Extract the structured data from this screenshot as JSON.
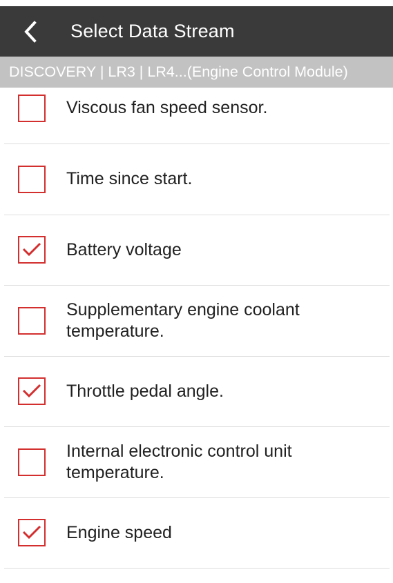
{
  "header": {
    "title": "Select Data Stream",
    "back_icon": "chevron-left-icon"
  },
  "subheader": {
    "text": "DISCOVERY | LR3 | LR4...(Engine Control Module)"
  },
  "colors": {
    "app_bar": "#3a3a3a",
    "sub_bar": "#c2c2c2",
    "checkbox_accent": "#d32f2f"
  },
  "items": [
    {
      "label": "Viscous fan speed sensor.",
      "checked": false
    },
    {
      "label": "Time since start.",
      "checked": false
    },
    {
      "label": "Battery voltage",
      "checked": true
    },
    {
      "label": "Supplementary engine coolant temperature.",
      "checked": false
    },
    {
      "label": "Throttle pedal angle.",
      "checked": true
    },
    {
      "label": "Internal electronic control unit temperature.",
      "checked": false
    },
    {
      "label": "Engine speed",
      "checked": true
    }
  ]
}
